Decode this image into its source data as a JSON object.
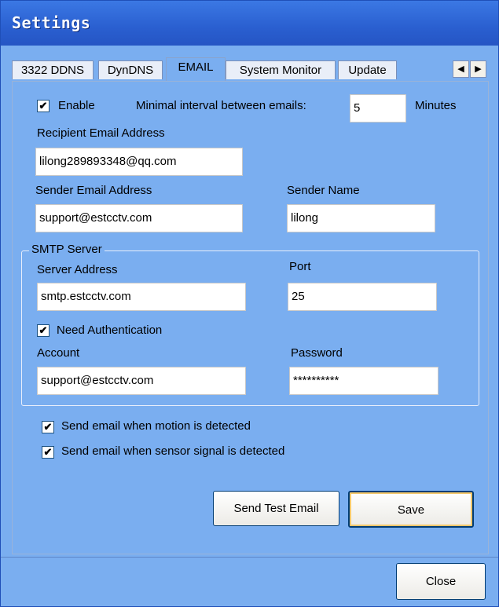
{
  "window": {
    "title": "Settings"
  },
  "tabs": [
    {
      "label": "3322 DDNS",
      "active": false
    },
    {
      "label": "DynDNS",
      "active": false
    },
    {
      "label": "EMAIL",
      "active": true
    },
    {
      "label": "System Monitor",
      "active": false
    },
    {
      "label": "Update",
      "active": false
    }
  ],
  "tab_scroll": {
    "left_icon": "arrow-left-icon",
    "right_icon": "arrow-right-icon",
    "left_glyph": "◀",
    "right_glyph": "▶"
  },
  "email": {
    "enable_label": "Enable",
    "enable_checked": true,
    "interval_label": "Minimal interval between emails:",
    "interval_value": "5",
    "interval_unit": "Minutes",
    "recipient_label": "Recipient Email Address",
    "recipient_value": "lilong289893348@qq.com",
    "sender_email_label": "Sender Email Address",
    "sender_email_value": "support@estcctv.com",
    "sender_name_label": "Sender Name",
    "sender_name_value": "lilong"
  },
  "smtp": {
    "group_title": "SMTP Server",
    "server_label": "Server Address",
    "server_value": "smtp.estcctv.com",
    "port_label": "Port",
    "port_value": "25",
    "auth_label": "Need Authentication",
    "auth_checked": true,
    "account_label": "Account",
    "account_value": "support@estcctv.com",
    "password_label": "Password",
    "password_value": "**********"
  },
  "options": {
    "motion_label": "Send email when motion is detected",
    "motion_checked": true,
    "sensor_label": "Send email when sensor signal is detected",
    "sensor_checked": true,
    "check_glyph": "✔"
  },
  "buttons": {
    "test_label": "Send Test Email",
    "save_label": "Save",
    "close_label": "Close"
  }
}
